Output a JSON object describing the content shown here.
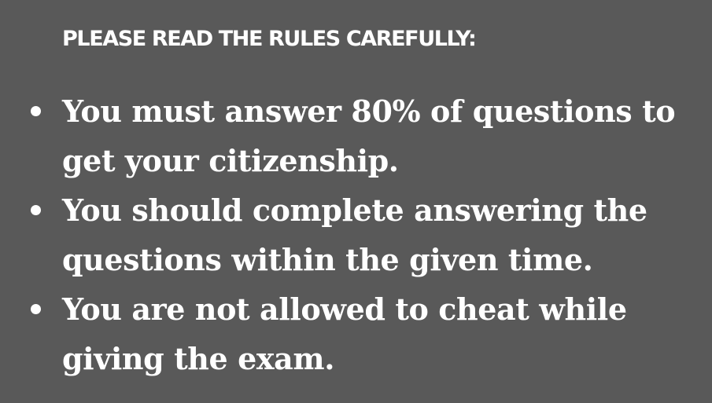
{
  "heading": "PLEASE READ THE RULES CAREFULLY:",
  "rules": [
    {
      "text": "You must answer 80% of questions to get your citizenship."
    },
    {
      "text": "You should complete answering the questions within the given time."
    },
    {
      "text": "You are not allowed to cheat while giving the exam."
    }
  ],
  "colors": {
    "background": "#595959",
    "text": "#ffffff"
  }
}
